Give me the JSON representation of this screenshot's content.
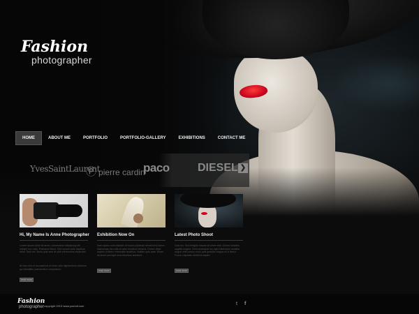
{
  "logo": {
    "title": "Fashion",
    "subtitle": "photographer"
  },
  "nav": {
    "items": [
      {
        "label": "HOME",
        "active": true
      },
      {
        "label": "ABOUT ME"
      },
      {
        "label": "PORTFOLIO"
      },
      {
        "label": "PORTFOLIO-GALLERY"
      },
      {
        "label": "EXHIBITIONS"
      },
      {
        "label": "CONTACT ME"
      }
    ]
  },
  "brands": {
    "ysl": "YvesSaintLaurent",
    "cardin_mark": "Ⓟ",
    "cardin": "pierre cardin",
    "paco": "paco",
    "diesel": "DIESEL",
    "next_icon": "arrow-right-icon"
  },
  "columns": [
    {
      "title": "Hi, My Name Is Anne Photographer",
      "text": "Lorem ipsum dolor sit amet, consectetur adipiscing elit. Integer nec odio. Praesent libero. Sed cursus ante dapibus diam. Sed nisi. Nulla quis sem at nibh elementum imperdiet.",
      "text2": "At vero eos et accusamus et iusto odio dignissimos ducimus qui blanditiis praesentium voluptatum.",
      "button": "read more"
    },
    {
      "title": "Exhibition Now On",
      "text": "Nam quam nunc blandit vel luctus pulvinar hendrerit id lorem. Maecenas nec odio et ante tincidunt tempus. Donec vitae sapien ut libero venenatis faucibus. Nullam quis ante. Etiam sit amet orci eget eros faucibus tincidunt.",
      "text2": "",
      "button": "read more"
    },
    {
      "title": "Latest Photo Shoot",
      "text": "Duis leo. Sed fringilla mauris sit amet nibh. Donec sodales sagittis magna. Sed consequat leo eget bibendum sodales augue velit cursus nunc quis gravida magna mi a libero. Fusce vulputate eleifend sapien.",
      "text2": "",
      "button": "read more"
    }
  ],
  "footer": {
    "logo": "Fashion",
    "logo_sub": "photographer",
    "copyright": "copyright 2013 www.yoursit.com",
    "twitter": "t",
    "facebook": "f"
  }
}
